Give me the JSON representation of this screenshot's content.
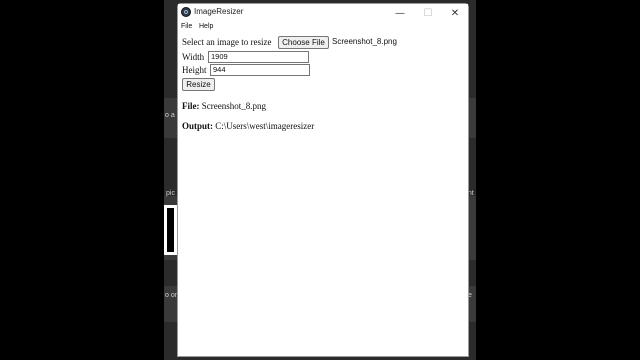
{
  "background": {
    "texts": [
      "o a",
      "pic",
      "o on",
      "ent",
      "e"
    ]
  },
  "window": {
    "title": "ImageResizer",
    "controls": {
      "minimize": "—",
      "maximize": "☐",
      "close": "✕"
    }
  },
  "menu": [
    "File",
    "Help"
  ],
  "form": {
    "select_label": "Select an image to resize",
    "choose_button": "Choose File",
    "selected_file": "Screenshot_8.png",
    "width_label": "Width",
    "width_value": "1909",
    "height_label": "Height",
    "height_value": "944",
    "resize_button": "Resize"
  },
  "info": {
    "file_label": "File:",
    "file_value": "Screenshot_8.png",
    "output_label": "Output:",
    "output_value": "C:\\Users\\west\\imageresizer"
  }
}
